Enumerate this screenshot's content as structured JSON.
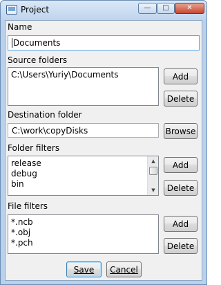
{
  "window": {
    "title": "Project",
    "icons": {
      "app": "project-window-icon",
      "minimize": "minimize-icon",
      "maximize": "maximize-icon",
      "close": "close-icon"
    },
    "glyphs": {
      "minimize": "—",
      "maximize": "□",
      "close": "✕"
    }
  },
  "name": {
    "label": "Name",
    "value": "Documents"
  },
  "source_folders": {
    "label": "Source folders",
    "items": [
      "C:\\Users\\Yuriy\\Documents"
    ],
    "add_label": "Add",
    "delete_label": "Delete"
  },
  "destination_folder": {
    "label": "Destination folder",
    "value": "C:\\work\\copyDisks",
    "browse_label": "Browse"
  },
  "folder_filters": {
    "label": "Folder filters",
    "items": [
      "release",
      "debug",
      "bin"
    ],
    "add_label": "Add",
    "delete_label": "Delete"
  },
  "file_filters": {
    "label": "File filters",
    "items": [
      "*.ncb",
      "*.obj",
      "*.pch"
    ],
    "add_label": "Add",
    "delete_label": "Delete"
  },
  "footer": {
    "save_label": "Save",
    "cancel_label": "Cancel"
  }
}
